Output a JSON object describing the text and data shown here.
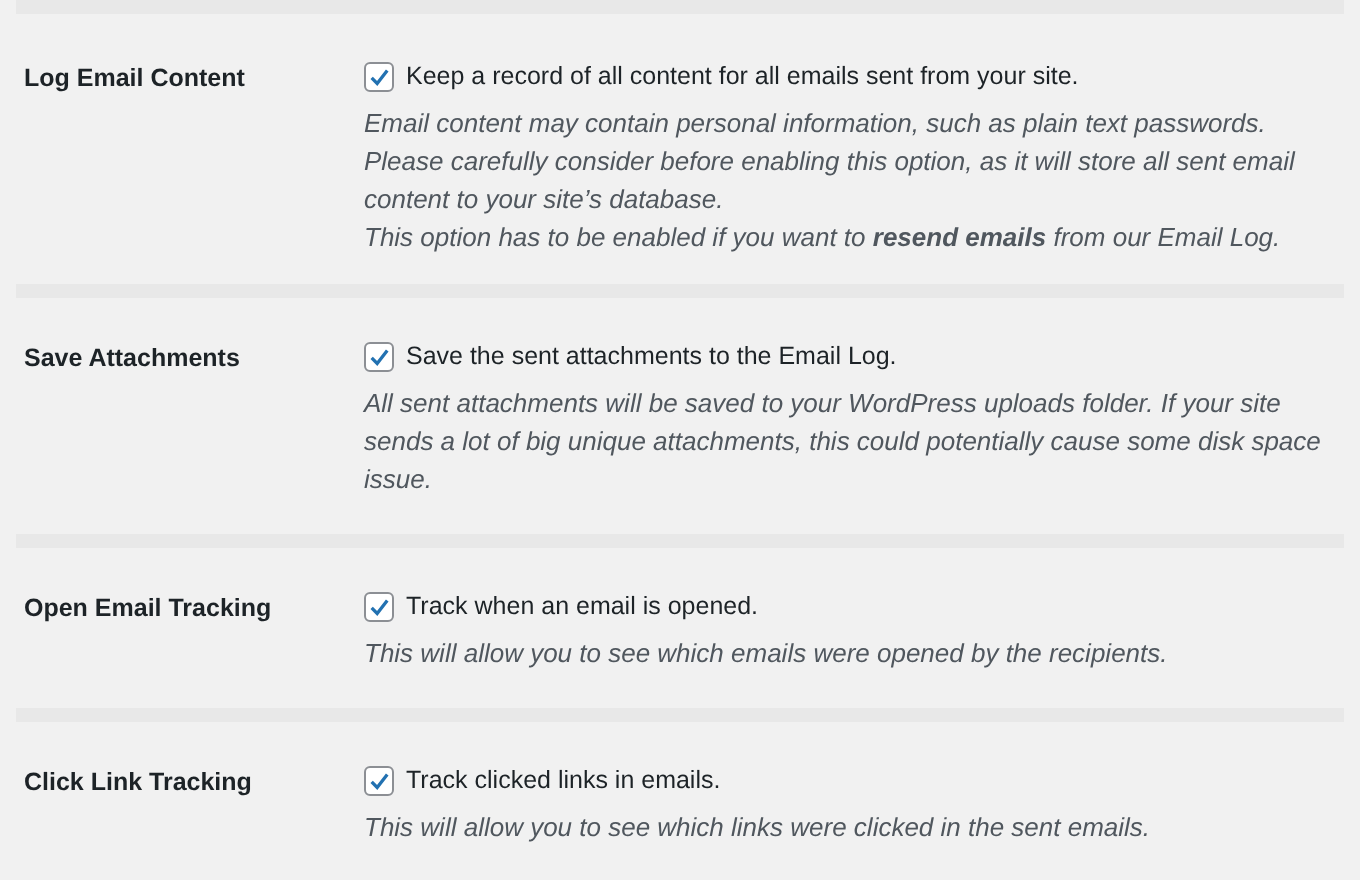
{
  "settings": [
    {
      "label": "Log Email Content",
      "checked": true,
      "option": "Keep a record of all content for all emails sent from your site.",
      "description": [
        "Email content may contain personal information, such as plain text passwords. Please carefully consider before enabling this option, as it will store all sent email content to your site’s database.",
        "This option has to be enabled if you want to **resend emails** from our Email Log."
      ]
    },
    {
      "label": "Save Attachments",
      "checked": true,
      "option": "Save the sent attachments to the Email Log.",
      "description": [
        "All sent attachments will be saved to your WordPress uploads folder. If your site sends a lot of big unique attachments, this could potentially cause some disk space issue."
      ]
    },
    {
      "label": "Open Email Tracking",
      "checked": true,
      "option": "Track when an email is opened.",
      "description": [
        "This will allow you to see which emails were opened by the recipients."
      ]
    },
    {
      "label": "Click Link Tracking",
      "checked": true,
      "option": "Track clicked links in emails.",
      "description": [
        "This will allow you to see which links were clicked in the sent emails."
      ]
    }
  ]
}
